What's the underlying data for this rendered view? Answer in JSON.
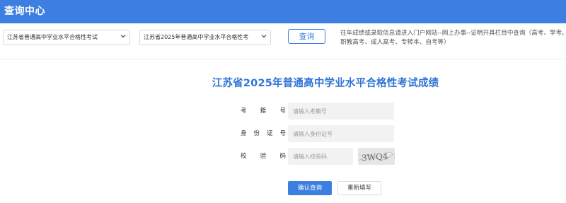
{
  "header": {
    "title": "查询中心"
  },
  "toolbar": {
    "select1": {
      "selected": "江苏省普通高中学业水平合格性考试"
    },
    "select2": {
      "selected": "江苏省2025年普通高中学业水平合格性考"
    },
    "query_label": "查询",
    "notice": "往年成绩或录取信息请进入门户网站--网上办事--证明开具栏目中查询（高考、学考、职教高考、成人高考、专转本、自考等）"
  },
  "form": {
    "title": "江苏省2025年普通高中学业水平合格性考试成绩",
    "fields": [
      {
        "label": "考 籍 号",
        "placeholder": "请输入考籍号"
      },
      {
        "label": "身份证号",
        "placeholder": "请输入身份证号"
      },
      {
        "label": "校 验 码",
        "placeholder": "请输入校验码"
      }
    ],
    "captcha_text": "3WQ4",
    "submit_label": "确认查询",
    "reset_label": "重新填写"
  },
  "colors": {
    "accent": "#3d7fe0",
    "title": "#2f74d6"
  },
  "icons": {
    "select_chevron": "chevron-down-icon",
    "captcha": "captcha-image"
  }
}
